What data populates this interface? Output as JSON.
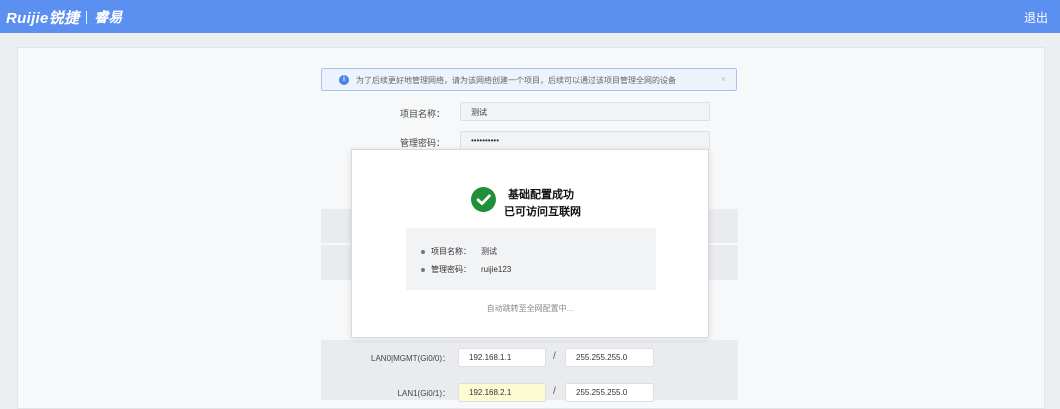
{
  "header": {
    "brand": "Ruijie锐捷",
    "product": "睿易",
    "logout": "退出"
  },
  "notice": {
    "text": "为了后续更好地管理网络，请为该网络创建一个项目，后续可以通过该项目管理全网的设备",
    "close": "×"
  },
  "form": {
    "project_label": "项目名称：",
    "project_value": "测试",
    "password_label": "管理密码：",
    "password_value": "••••••••••"
  },
  "modal": {
    "title": "基础配置成功",
    "subtitle": "已可访问互联网",
    "summary": [
      {
        "key": "项目名称：",
        "value": "测试"
      },
      {
        "key": "管理密码：",
        "value": "ruijie123"
      }
    ],
    "redirect": "自动跳转至全网配置中..."
  },
  "network": {
    "rows": [
      {
        "label": "LAN0|MGMT(Gi0/0)：",
        "ip": "192.168.1.1",
        "mask": "255.255.255.0",
        "highlight": false
      },
      {
        "label": "LAN1(Gi0/1)：",
        "ip": "192.168.2.1",
        "mask": "255.255.255.0",
        "highlight": true
      }
    ],
    "separator": "/"
  },
  "colors": {
    "header": "#5b8ff0",
    "success": "#1f8f38",
    "info": "#4a86e8"
  }
}
